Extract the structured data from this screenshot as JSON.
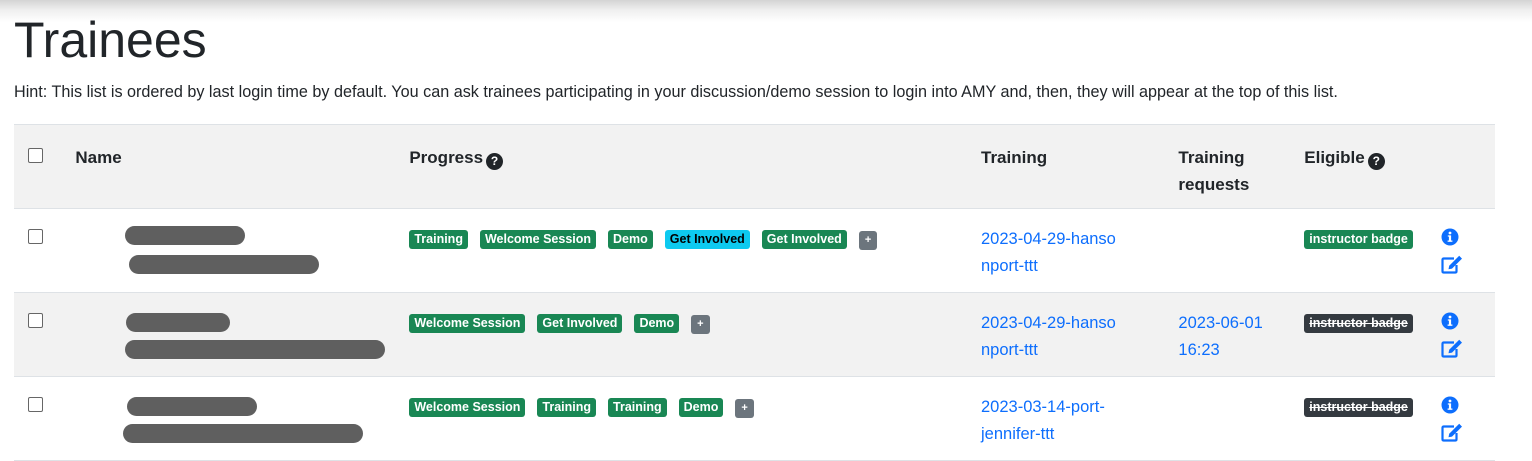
{
  "page": {
    "title": "Trainees",
    "hint": "Hint: This list is ordered by last login time by default. You can ask trainees participating in your discussion/demo session to login into AMY and, then, they will appear at the top of this list."
  },
  "table": {
    "headers": {
      "name": "Name",
      "progress": "Progress",
      "training": "Training",
      "requests": "Training requests",
      "eligible": "Eligible"
    },
    "rows": [
      {
        "progress": [
          "Training",
          "Welcome Session",
          "Demo",
          "Get Involved",
          "Get Involved"
        ],
        "more": "+",
        "training": "2023-04-29-hansonport-ttt",
        "request": "",
        "eligible": "instructor badge"
      },
      {
        "progress": [
          "Welcome Session",
          "Get Involved",
          "Demo"
        ],
        "more": "+",
        "training": "2023-04-29-hansonport-ttt",
        "request": "2023-06-01 16:23",
        "eligible": "instructor badge"
      },
      {
        "progress": [
          "Welcome Session",
          "Training",
          "Training",
          "Demo"
        ],
        "more": "+",
        "training": "2023-03-14-port-jennifer-ttt",
        "request": "",
        "eligible": "instructor badge"
      }
    ]
  },
  "colors": {
    "success": "#198754",
    "info": "#0dcaf0",
    "secondary": "#6c757d",
    "dark": "#343a40",
    "link": "#0d6efd"
  },
  "icons": {
    "help": "question-circle-icon",
    "info": "info-circle-icon",
    "edit": "edit-icon"
  }
}
